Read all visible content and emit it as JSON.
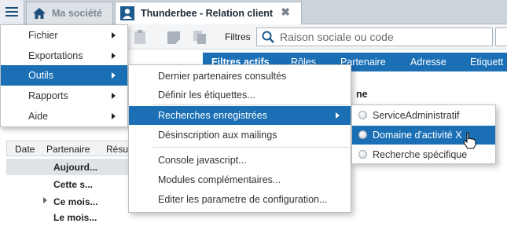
{
  "tabs": {
    "company": "Ma société",
    "active": "Thunderbee - Relation client"
  },
  "toolbar": {
    "filters_label": "Filtres",
    "search_placeholder": "Raison sociale ou code"
  },
  "bluebar": {
    "tabs": [
      "Filtres actifs",
      "Rôles",
      "Partenaire",
      "Adresse",
      "Etiquett"
    ]
  },
  "background": {
    "partial_label": "ne"
  },
  "grid": {
    "columns": [
      "Date",
      "Partenaire",
      "Résu"
    ],
    "rows": [
      "Aujourd...",
      "Cette s...",
      "Ce mois...",
      "Le mois..."
    ]
  },
  "main_menu": {
    "items": [
      "Fichier",
      "Exportations",
      "Outils",
      "Rapports",
      "Aide"
    ]
  },
  "tools_menu": {
    "items": [
      "Dernier partenaires consultés",
      "Définir les étiquettes...",
      "Recherches enregistrées",
      "Désinscription aux mailings",
      "Console javascript...",
      "Modules complémentaires...",
      "Editer les parametre de configuration..."
    ]
  },
  "saved_searches": {
    "items": [
      "ServiceAdministratif",
      "Domaine d'activité X",
      "Recherche spécifique"
    ]
  },
  "colors": {
    "accent": "#1a6fb5",
    "tabbar": "#cdd3da"
  }
}
